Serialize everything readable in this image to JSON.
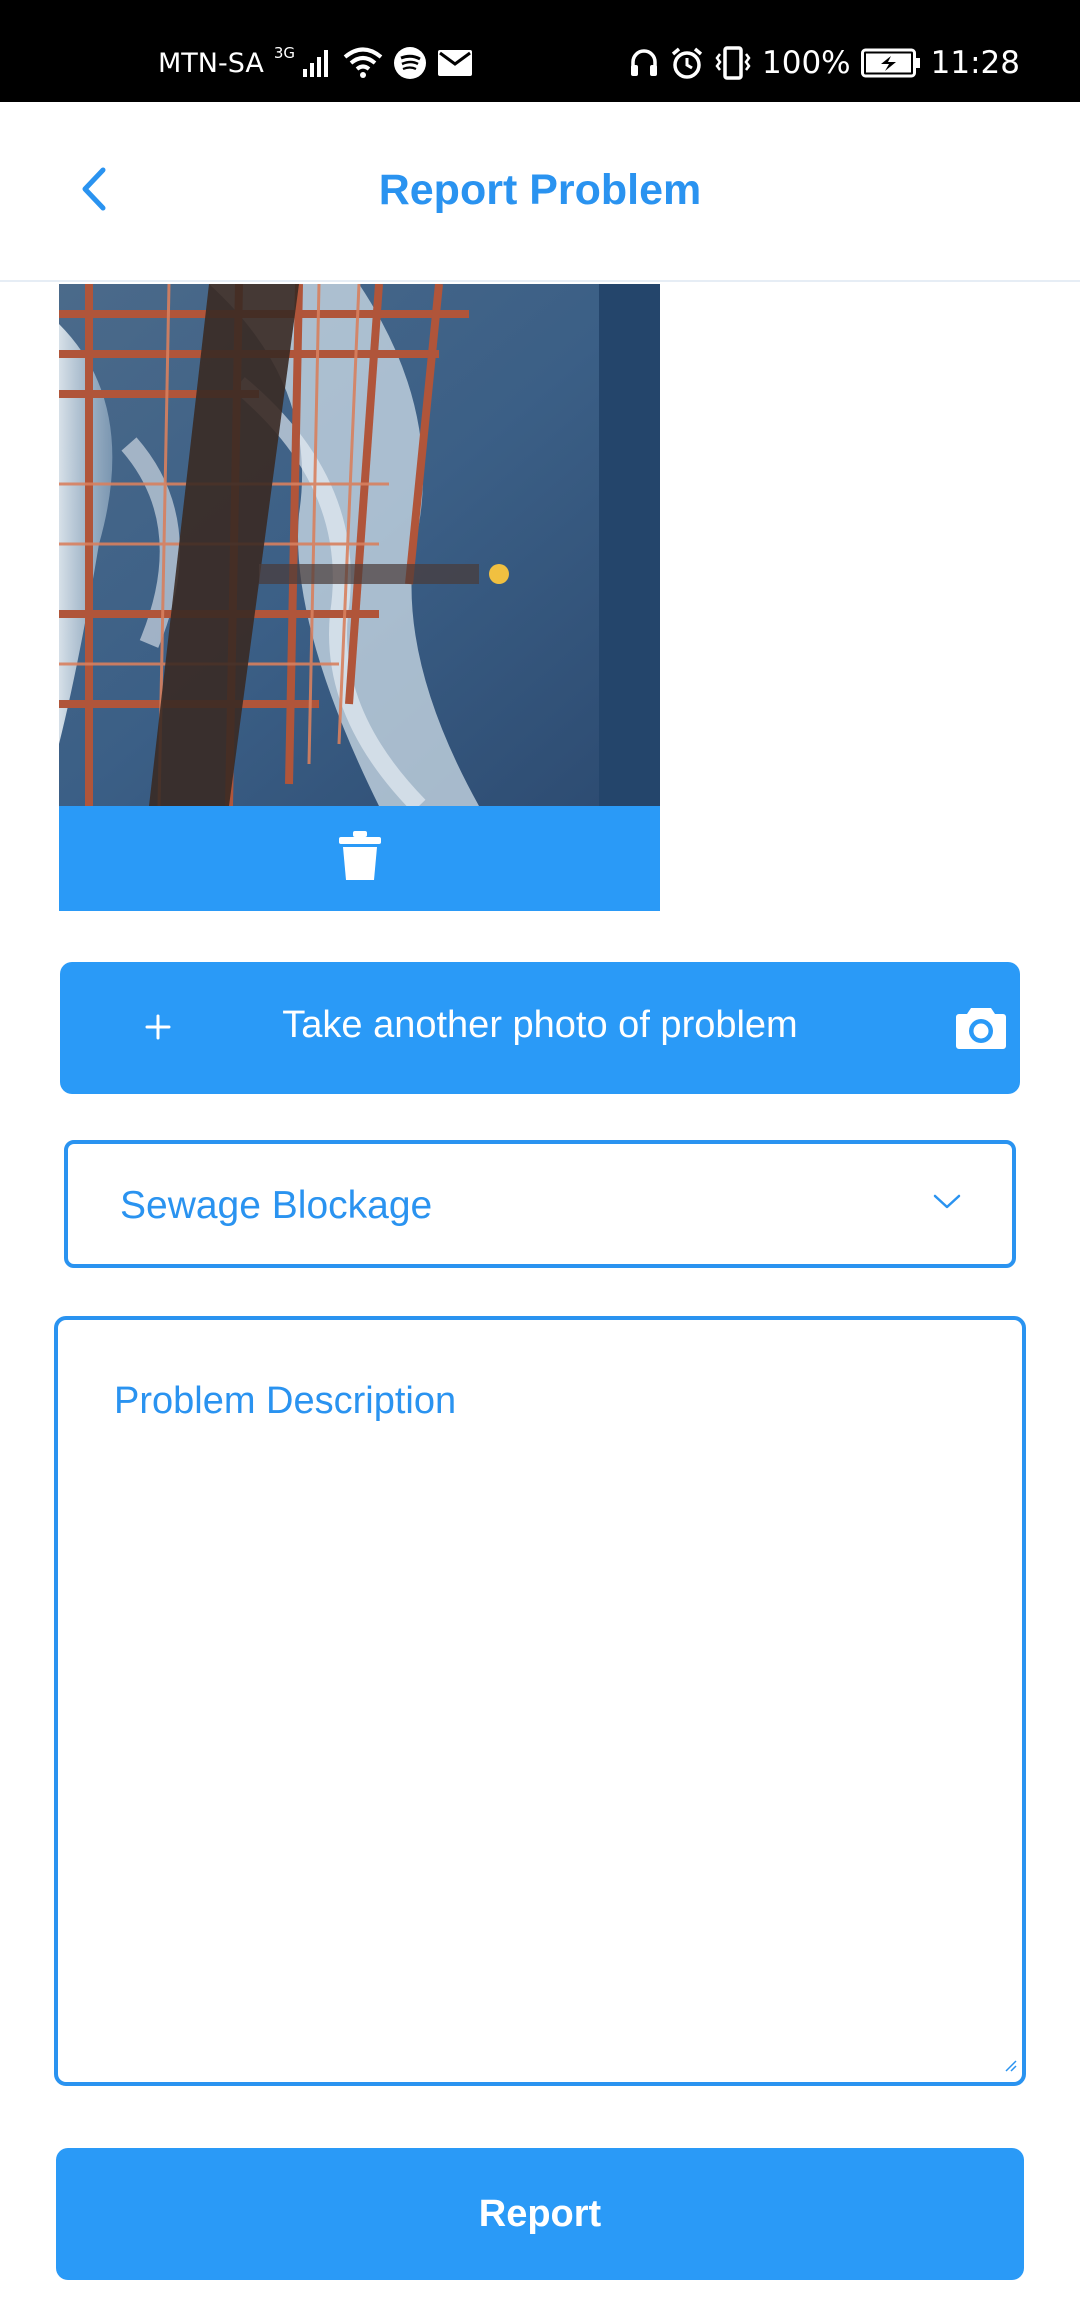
{
  "status_bar": {
    "carrier": "MTN-SA",
    "network_type": "3G",
    "battery_percent": "100%",
    "time": "11:28",
    "left_icons": [
      "signal-icon",
      "wifi-icon",
      "spotify-icon",
      "mail-icon"
    ],
    "right_icons": [
      "headphones-icon",
      "alarm-icon",
      "vibrate-icon",
      "battery-charging-icon"
    ]
  },
  "app_bar": {
    "title": "Report Problem",
    "back_icon": "chevron-left-icon"
  },
  "photo": {
    "delete_icon": "trash-icon"
  },
  "take_photo_button": {
    "label": "Take another photo of problem",
    "plus_icon": "plus-icon",
    "camera_icon": "camera-icon"
  },
  "category_select": {
    "value": "Sewage Blockage",
    "icon": "chevron-down-icon"
  },
  "description": {
    "placeholder": "Problem Description",
    "value": ""
  },
  "report_button": {
    "label": "Report"
  },
  "colors": {
    "accent": "#2a93f0",
    "button": "#2a9af7",
    "status_bar": "#000000",
    "background": "#ffffff"
  }
}
